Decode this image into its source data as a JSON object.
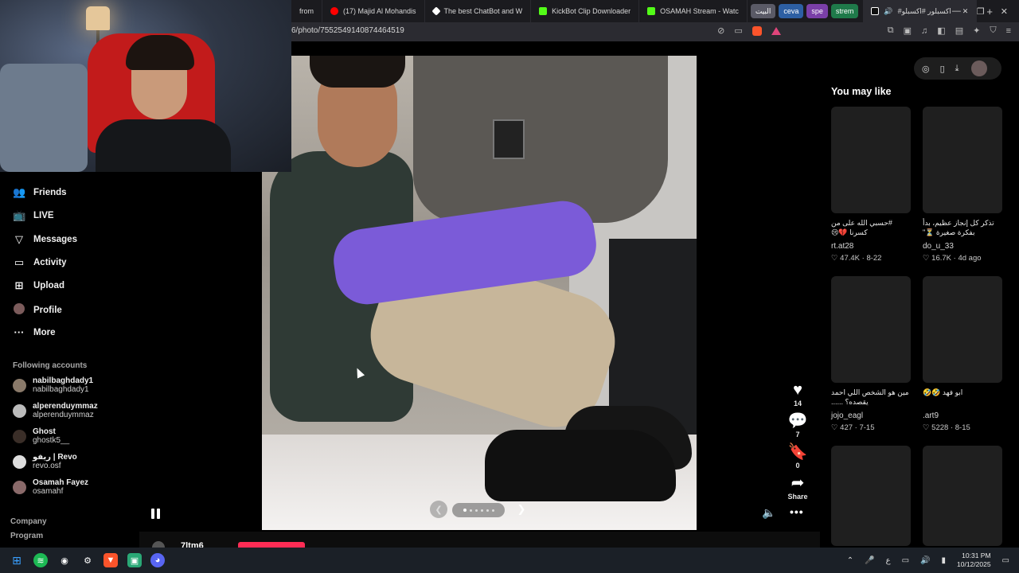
{
  "browser": {
    "tabs": [
      {
        "label": "from",
        "color": "#2c2c2c"
      },
      {
        "label": "(17) Majid Al Mohandis",
        "color": "#ff0000"
      },
      {
        "label": "The best ChatBot and W",
        "color": "#ffffff"
      },
      {
        "label": "KickBot Clip Downloader",
        "color": "#53fc18"
      },
      {
        "label": "OSAMAH Stream - Watc",
        "color": "#53fc18"
      }
    ],
    "pills": [
      {
        "label": "البيت",
        "color": "#5a5a66"
      },
      {
        "label": "ceva",
        "color": "#2d5fa3"
      },
      {
        "label": "spe",
        "color": "#7a3fa8"
      },
      {
        "label": "strem",
        "color": "#1f7a4a"
      }
    ],
    "active_tab": "#اكسبلور #اكسبلو",
    "close_tab_glyph": "✕",
    "new_tab_glyph": "+",
    "window_controls": [
      "—",
      "❐",
      "✕"
    ],
    "url": "6/photo/7552549140874464519"
  },
  "sidebar": {
    "nav": [
      {
        "label": "Friends",
        "icon": "friends-icon",
        "glyph": "👥"
      },
      {
        "label": "LIVE",
        "icon": "live-icon",
        "glyph": "📺"
      },
      {
        "label": "Messages",
        "icon": "messages-icon",
        "glyph": "▽"
      },
      {
        "label": "Activity",
        "icon": "activity-icon",
        "glyph": "▭"
      },
      {
        "label": "Upload",
        "icon": "upload-icon",
        "glyph": "⊞"
      },
      {
        "label": "Profile",
        "icon": "profile-avatar",
        "glyph": ""
      },
      {
        "label": "More",
        "icon": "more-icon",
        "glyph": "···"
      }
    ],
    "following_title": "Following accounts",
    "accounts": [
      {
        "name": "nabilbaghdady1",
        "handle": "nabilbaghdady1"
      },
      {
        "name": "alperenduymmaz",
        "handle": "alperenduymmaz"
      },
      {
        "name": "Ghost",
        "handle": "ghostk5__"
      },
      {
        "name": "ريفو | Revo",
        "handle": "revo.osf"
      },
      {
        "name": "Osamah Fayez",
        "handle": "osamahf"
      }
    ],
    "footer": [
      "Company",
      "Program"
    ]
  },
  "post": {
    "username": "7ltm6",
    "likes": "14",
    "comments": "7",
    "saves": "0",
    "share_label": "Share"
  },
  "right_panel": {
    "title": "You may like",
    "cards": [
      {
        "desc": "#حسبي الله على من كسرنا 💔😢",
        "user": "rt.at28",
        "likes": "47.4K",
        "date": "8-22"
      },
      {
        "desc": "تذكر كل إنجاز عظيم، بدأ بفكرة صغيرة ⏳\" #النجاح...",
        "user": "do_u_33",
        "likes": "16.7K",
        "date": "4d ago"
      },
      {
        "desc": "مين هو الشخص اللي احمد يقصده؟ ......",
        "user": "jojo_eagl",
        "likes": "427",
        "date": "7-15"
      },
      {
        "desc": "ابو فهد 🤣🤣",
        "user": ".art9",
        "likes": "5228",
        "date": "8-15"
      }
    ]
  },
  "taskbar": {
    "time": "10:31 PM",
    "date": "10/12/2025",
    "lang": "ع"
  }
}
